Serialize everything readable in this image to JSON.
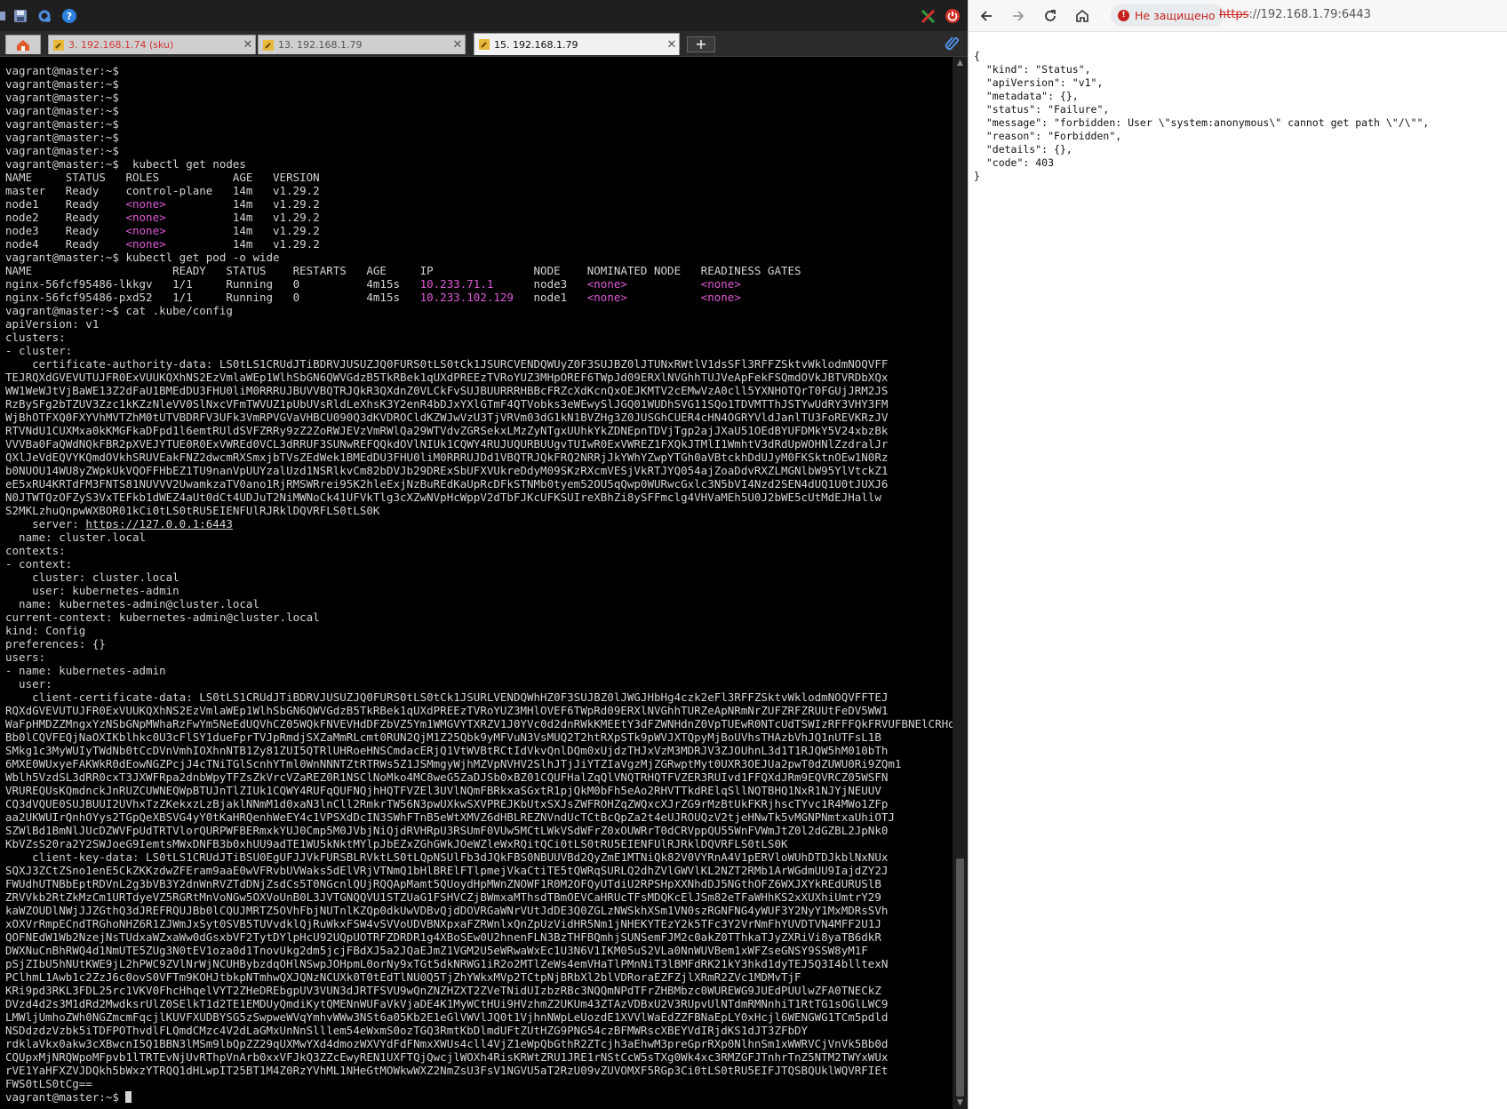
{
  "terminal_app": {
    "toolbar_icons": [
      "terminal-icon",
      "save-icon",
      "settings-icon",
      "help-icon",
      "tools-icon",
      "power-icon"
    ],
    "tabs": [
      {
        "label": "3. 192.168.1.74 (sku)",
        "icon": "key-icon",
        "active": false
      },
      {
        "label": "13. 192.168.1.79",
        "icon": "key-icon",
        "active": false
      },
      {
        "label": "15. 192.168.1.79",
        "icon": "key-icon",
        "active": true
      }
    ],
    "new_tab": "+",
    "colors": {
      "background": "#000000",
      "text": "#d4d4d4",
      "highlight": "#e05ad7"
    }
  },
  "terminal": {
    "cursor_prompt": "vagrant@master:~$ ",
    "lines": [
      "vagrant@master:~$",
      "vagrant@master:~$",
      "vagrant@master:~$",
      "vagrant@master:~$",
      "vagrant@master:~$",
      "vagrant@master:~$",
      "vagrant@master:~$",
      "vagrant@master:~$  kubectl get nodes",
      "NAME     STATUS   ROLES           AGE   VERSION",
      "master   Ready    control-plane   14m   v1.29.2",
      [
        "node1    Ready    ",
        {
          "hl": "<none>"
        },
        "          14m   v1.29.2"
      ],
      [
        "node2    Ready    ",
        {
          "hl": "<none>"
        },
        "          14m   v1.29.2"
      ],
      [
        "node3    Ready    ",
        {
          "hl": "<none>"
        },
        "          14m   v1.29.2"
      ],
      [
        "node4    Ready    ",
        {
          "hl": "<none>"
        },
        "          14m   v1.29.2"
      ],
      "vagrant@master:~$ kubectl get pod -o wide",
      "NAME                     READY   STATUS    RESTARTS   AGE     IP               NODE    NOMINATED NODE   READINESS GATES",
      [
        "nginx-56fcf95486-lkkgv   1/1     Running   0          4m15s   ",
        {
          "hl": "10.233.71.1"
        },
        "      node3   ",
        {
          "hl": "<none>"
        },
        "           ",
        {
          "hl": "<none>"
        }
      ],
      [
        "nginx-56fcf95486-pxd52   1/1     Running   0          4m15s   ",
        {
          "hl": "10.233.102.129"
        },
        "   node1   ",
        {
          "hl": "<none>"
        },
        "           ",
        {
          "hl": "<none>"
        }
      ],
      "vagrant@master:~$ cat .kube/config",
      "apiVersion: v1",
      "clusters:",
      "- cluster:",
      "    certificate-authority-data: LS0tLS1CRUdJTiBDRVJUSUZJQ0FURS0tLS0tCk1JSURCVENDQWUyZ0F3SUJBZ0lJTUNxRWtlV1dsSFl3RFFZSktvWklodmNOQVFF",
      "TEJRQXdGVEVUTUJFR0ExVUUKQXhNS2EzVmlaWEp1WlhSbGN6QWVGdzB5TkRBek1qUXdPREEzTVRoYUZ3MHpOREF6TWpJd09ERXlNVGhhTUJVeApFekFSQmdOVkJBTVRDbXQx",
      "WW1WeWJtVjBaWE13Z2dFaU1BMEdDU3FHU0liM0RRRUJBUVVBQTRJQkR3QXdnZ0VLCkFvSUJBUURRRHBBcFRZcXdKcnQxOEJKMTV2cEMwVzA0cll5YXNHOTQrT0FGUjJRM2JS",
      "RzBySFg2bTZUV3Zzc1kKZzNleVV0SlNxcVFmTWVUZ1pUbUVsRldLeXhsK3Y2enR4bDJxYXlGTmF4QTVobks3eWEwySlJGQ01WUDhSVG11SQo1TDVMTThJSTYwUdRY3VHY3FM",
      "WjBhOTFXQ0FXYVhMVTZhM0tUTVBDRFV3UFk3VmRPVGVaVHBCU090Q3dKVDROCldKZWJwVzU3TjVRVm03dG1kN1BVZHg3Z0JUSGhCUER4cHN4OGRYVldJanlTU3FoREVKRzJV",
      "RTVNdU1CUXMxa0kKMGFkaDFpd1l6emtRUldSVFZRRy9zZ2ZoRWJEVzVmRWlQa29WTVdvZGRSekxLMzZyNTgxUUhkYkZDNEpnTDVjTgp2ajJXaU51OEdBYUFDMkY5V24xbzBk",
      "VVVBa0FaQWdNQkFBR2pXVEJYTUE0R0ExVWREd0VCL3dRRUF3SUNwREFQQkdOVlNIUk1CQWY4RUJUQURBUUgvTUIwR0ExVWREZ1FXQkJTMlI1WmhtV3dRdUpWOHNlZzdralJr",
      "QXlJeVdEQVYKQmdOVkhSRUVEakFNZ2dwcmRXSmxjbTVsZEdWek1BMEdDU3FHU0liM0RRRUJDd1VBQTRJQkFRQ2NRRjJkYWhYZwpYTGh0aVBtckhDdUJyM0FKSktnOEw1N0Rz",
      "b0NUOU14WU8yZWpkUkVQOFFHbEZ1TU9nanVpUUYzalUzd1NSRlkvCm82bDVJb29DRExSbUFXVUkreDdyM09SKzRXcmVESjVkRTJYQ054ajZoaDdvRXZLMGNlbW95YlVtckZ1",
      "eE5xRU4KRTdFM3FNTS81NUVVV2UwamkzaTV0ano1RjRMSWRrei95K2hleExjNzBuREdKaUpRcDFkSTNMb0tyem52OU5qQwp0WURwcGxlc3N5bVI4Nzd2SEN4dUQ1U0tJUXJ6",
      "N0JTWTQzOFZyS3VxTEFkb1dWEZ4aUt0dCt4UDJuT2NiMWNoCk41UFVkTlg3cXZwNVpHcWppV2dTbFJKcUFKSUIreXBhZi8ySFFmclg4VHVaMEh5U0J2bWE5cUtMdEJHallw",
      "S2MKLzhuQnpwWXBOR01kCi0tLS0tRU5EIENFUlRJRklDQVRFLS0tLS0K",
      [
        "    server: ",
        {
          "ul": "https://127.0.0.1:6443"
        }
      ],
      "  name: cluster.local",
      "contexts:",
      "- context:",
      "    cluster: cluster.local",
      "    user: kubernetes-admin",
      "  name: kubernetes-admin@cluster.local",
      "current-context: kubernetes-admin@cluster.local",
      "kind: Config",
      "preferences: {}",
      "users:",
      "- name: kubernetes-admin",
      "  user:",
      "    client-certificate-data: LS0tLS1CRUdJTiBDRVJUSUZJQ0FURS0tLS0tCk1JSURLVENDQWhHZ0F3SUJBZ0lJWGJHbHg4czk2eFl3RFFZSktvWklodmNOQVFFTEJ",
      "RQXdGVEVUTUJFR0ExVUUKQXhNS2EzVmlaWEp1WlhSbGN6QWVGdzB5TkRBek1qUXdPREEzTVRoYUZ3MHlOVEF6TWpRd09ERXlNVGhhTURZeApNRmNrZUFZRFZRUUtFeDV5WW1",
      "WaFpHMDZZMngxYzNSbGNpMWhaRzFwYm5NeEdUQVhCZ05WQkFNVEVHdDFZbVZ5Ym1WMGVYTXRZV1J0YVc0d2dnRWkKMEEtY3dFZWNHdnZ0VpTUEwR0NTcUdTSWIzRFFFQkFRVUFBNElCRHdBd2dnRUt",
      "Bb0lCQVFEQjNaOXIKblhkc0U3cFlSY1dueFprTVJpRmdjSXZaMmRLcmt0RUN2QjM1Z25Qbk9yMFVuN3VsMUQ2T2htRXpSTk9pWVJXTQpyMjBoUVhsTHAzbVhJQ1nUTFsL1B",
      "SMkg1c3MyWUIyTWdNb0tCcDVnVmhIOXhnNTB1Zy81ZUI5QTRlUHRoeHNSCmdacERjQ1VtWVBtRCtIdVkvQnlDQm0xUjdzTHJxVzM3MDRJV3ZJOUhnL3d1T1RJQW5hM010bTh",
      "6MXE0WUxyeFAKWkR0dEowNGZPcjJ4cTNiTGlScnhYTml0WnNNNTZtRTRWs5Z1JSMmgyWjhMZVpNVHV2SlhJTjJiYTZIaVgzMjZGRwptMyt0UXR3OEJUa2pwT0dZUWU0Ri9ZQm1",
      "Wblh5VzdSL3dRR0cxT3JXWFRpa2dnbWpyTFZsZkVrcVZaREZ0R1NSClNoMko4MC8weG5ZaDJSb0xBZ01CQUFHalZqQlVNQTRHQTFVZER3RUIvd1FFQXdJRm9EQVRCZ05WSFN",
      "VRUREQUsKQmdnckJnRUZCUWNEQWpBTUJnTlZIUk1CQWY4RUFqQUFNQjhHQTFVZEl3UVlNQmFBRkxaSGxtR1pjQkM0bFh5eAo2RHVTTkdRElqSllNQTBHQ1NxR1NJYjNEUUV",
      "CQ3dVQUE0SUJBUUI2UVhxTzZKekxzLzBjaklNNmM1d0xaN3lnCll2RmkrTW56N3pwUXkwSXVPREJKbUtxSXJsZWFROHZqZWQxcXJrZG9rMzBtUkFKRjhscTYvc1R4MWo1ZFp",
      "aa2UKWUIrQnhOYys2TGpQeXBSVG4yY0tKaHRQenhWeEY4c1VPSXdDcIN3SWhFTnB5eWtXMVZ6dHBLREZNVndUcTCtBcQpZa2t4eUJROUQzV2tjeHNwTk5vMGNPNmtxaUhiOTJ",
      "SZWlBd1BmNlJUcDZWVFpUdTRTVlorQURPWFBERmxkYUJ0Cmp5M0JVbjNiQjdRVHRpU3RSUmF0VUw5MCtLWkVSdWFrZ0xOUWRrT0dCRVppQU55WnFVWmJtZ0l2dGZBL2JpNk0",
      "KbVZsS20ra2Y2SWJoeG9IemtsMWxDNFB3b0xhUU9adTE1WU5kNktMYlpJbEZxZGhGWkJOeWZleWxRQitQCi0tLS0tRU5EIENFUlRJRklDQVRFLS0tLS0K",
      "    client-key-data: LS0tLS1CRUdJTiBSU0EgUFJJVkFURSBLRVktLS0tLQpNSUlFb3dJQkFBS0NBUUVBd2QyZmE1MTNiQk82V0VYRnA4V1pERVloWUhDTDJkblNxNUx",
      "SQXJ3ZCtZSno1enE5CkZKKzdwZFEram9aaE0wVFRvbUVWaks5dElVRjVTNmQ1bHlBRElFTlpmejVkaCtiTE5tQWRqSURLQ2dhZVlGWVlKL2NZT2RMb1ArWGdmUU9IajdZY2J",
      "FWUdhUTNBbEptRDVnL2g3bVB3Y2dnWnRVZTdDNjZsdCs5T0NGcnlQUjRQQApMamt5QUoydHpMWnZNOWF1R0M2OFQyUTdiU2RPSHpXXNhdDJ5NGthOFZ6WXJXYkREdURUSlB",
      "ZRVVkb2RtZkMzCm1URTdyeVZ5RGRtMnVoNGw5OXVoUnB0L3JVTGNQQVU1STZUaG1FSHVCZjBWmxaMThsdTBmOEVCaHRUcTFsMDQKcElJSm82eTFaWHhKS2xXUXhiUmtrY29",
      "kaWZOUDlNWjJJZGthQ3dJREFRQUJBb0lCQUJMRTZ5OVhFbjNUTnlKZQp0dkUwVDBvQjdDOVRGaWNrVUtJdDE3Q0ZGLzNWSkhXSm1VN0szRGNFNG4yWUF3Y2NyY1MxMDRsSVh",
      "xOXVrRmpECndTRGhoNHZ6R1ZJWmJxSyt0SVB5TUVvdklQjRuWkxFSW4vSVVoUDVBNXpxaFZRWnlxQnZpUzVidHR5Nm1jNHEKYTEzY2k5TFc3Y2VrNmFhYUVDTVN4MFF2U1J",
      "QOFNEdW1Wb2NzejNsTUdxaWZxaWw0dGsxbVF2TytDYlpHcU92UQpUOTRFZDRDR1g4XBoSEw0U2hnenFLN3BzTHFBQmhjSUNSemFJM2c0akZ0TThkaTJyZXRiVi8yaTB6dkR",
      "DWXNuCnBhRWQ4d1NmUTE5ZUg3N0tEV1oza0d1TnovUkg2dm5jcjFBdXJ5a2JQaEJmZ1VGM2U5eWRwaWxEc1U3N6V1IKM05uS2VLa0NnWUVBem1xWFZseGNSY9SSW8yM1F",
      "pSjZIbU5hNUtKWE9jL2hPWC9ZVlNrWjNCUHBybzdqOHlNSwpJOHpmL0orNy9xTGt5dkNRWG1iR2o2MTlZeWs4emVHaTlPMnNiT3lBMFdRK21kY3hkd1dyTEJ5Q3I4blltexN",
      "PClhmL1Awb1c2ZzJ6c0ovS0VFTm9KOHJtbkpNTmhwQXJQNzNCUXk0T0tEdTlNU0Q5TjZhYWkxMVp2TCtpNjBRbXl2blVDRoraEZFZjlXRmR2ZVc1MDMvTjF",
      "KRi9pd3RKL3FDL25rc1VKV0FhcHhqelVYT2ZHeDREbgpUV3VUN3dJRTFSVU9wQnZNZHZXT2ZVeTNidUIzbzRBc3NQQmNPdTFrZHBMbzc0WUREWG9JUEdPUUlwZFA0TNECkZ",
      "DVzd4d2s3M1dRd2MwdksrUlZ0SElkT1d2TE1EMDUyQmdiKytQMENnWUFaVkVjaDE4K1MyWCtHUi9HVzhmZ2UKUm43ZTAzVDBxU2V3RUpvUlNTdmRMNnhiT1RtTG1sOGlLWC9",
      "LMWljUmhoZWh0NGZmcmFqcjlKUVFXUDBYSG5zSwpweWVqYmhvWWw3NSt6a05Kb2E1eGlVWVlJQ0t1VjhnNWpLeUozdE1XVVlWaEdZZFBNaEpLY0xHcjl6WENGWG1TCm5pdld",
      "NSDdzdzVzbk5iTDFPOThvdlFLQmdCMzc4V2dLaGMxUnNnSlllem54eWxmS0ozTGQ3RmtKbDlmdUFtZUtHZG9PNG54czBFMWRscXBEYVdIRjdKS1dJT3ZFbDY",
      "rdklaVkx0akw3cXBwcnI5Q1BBN3lMSm9lbQpZZ29qUXMwYXd4dmozWXVYdFdFNmxXWUs4cll4VjZ1eWpQbGthR2ZTcjh3aEhwM3preGprRXp0NlhnSm1xWWRVCjVnVk5Bb0d",
      "CQUpxMjNRQWpoMFpvb1lTRTEvNjUvRThpVnArb0xxVFJkQ3ZZcEwyREN1UXFTQjQwcjlWOXh4RisKRWtZRU1JRE1rNStCcW5sTXg0Wk4xc3RMZGFJTnhrTnZ5NTM2TWYxWUx",
      "rVE1YaHFXZVJDQkh5bWxzYTRQQ1dHLwpIT25BT1M4Z0RzYVhML1NHeGtMOWkwWXZ2NmZsU3FsV1NGVU5aT2RzU09vZUVOMXF5RGp3Ci0tLS0tRU5EIFJTQSBQUklWQVRFIEt",
      "FWS0tLS0tCg=="
    ]
  },
  "browser": {
    "nav": {
      "back_icon": "arrow-left-icon",
      "forward_icon": "arrow-right-icon",
      "reload_icon": "reload-icon",
      "home_icon": "home-icon"
    },
    "security_label": "Не защищено",
    "url_scheme": "https",
    "url_rest": "://192.168.1.79:6443",
    "json_lines": [
      "{",
      "  \"kind\": \"Status\",",
      "  \"apiVersion\": \"v1\",",
      "  \"metadata\": {},",
      "  \"status\": \"Failure\",",
      "  \"message\": \"forbidden: User \\\"system:anonymous\\\" cannot get path \\\"/\\\"\",",
      "  \"reason\": \"Forbidden\",",
      "  \"details\": {},",
      "  \"code\": 403",
      "}"
    ]
  }
}
